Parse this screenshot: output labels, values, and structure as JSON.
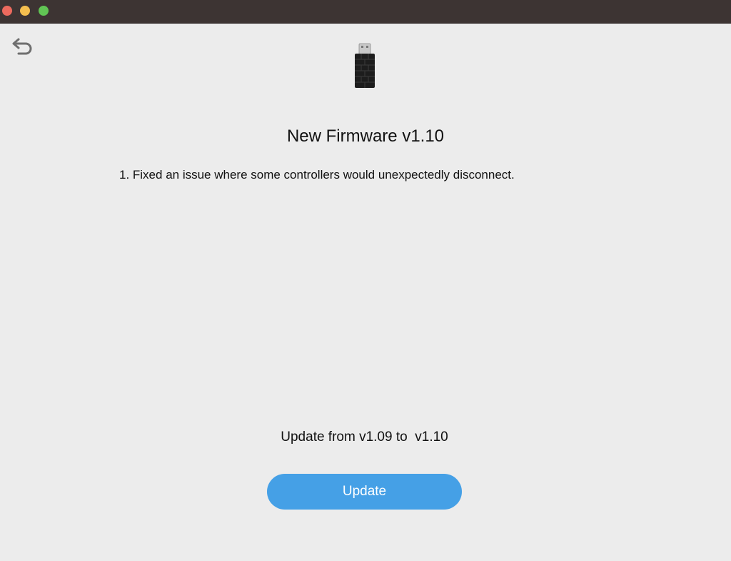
{
  "window": {
    "traffic_lights": {
      "close_color": "#ed6a5e",
      "minimize_color": "#f5bf4f",
      "zoom_color": "#61c554"
    }
  },
  "toolbar": {
    "back_icon": "undo-arrow-icon"
  },
  "device": {
    "icon": "usb-dongle-icon"
  },
  "main": {
    "title": "New Firmware v1.10",
    "notes": [
      "1. Fixed an issue where some controllers would unexpectedly disconnect."
    ],
    "version_line": "Update from v1.09 to  v1.10",
    "update_label": "Update",
    "accent_color": "#45a0e6"
  }
}
